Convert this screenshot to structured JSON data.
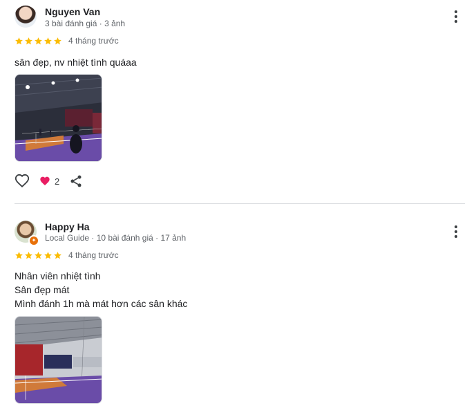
{
  "reviews": [
    {
      "author": "Nguyen Van",
      "meta": "3 bài đánh giá · 3 ảnh",
      "rating": 5,
      "time": "4 tháng trước",
      "text_lines": [
        "sân đẹp, nv nhiệt tình quáaa"
      ],
      "reaction_count": "2"
    },
    {
      "author": "Happy Ha",
      "meta": "Local Guide · 10 bài đánh giá · 17 ảnh",
      "rating": 5,
      "time": "4 tháng trước",
      "text_lines": [
        "Nhân viên nhiệt tình",
        "Sân đẹp mát",
        "Mình đánh 1h mà mát hơn các sân khác"
      ]
    }
  ],
  "colors": {
    "star": "#fbbc04",
    "heart_reaction": "#e91e63",
    "court": "#6a4ca8"
  },
  "icons": [
    "more-vert-icon",
    "star-icon",
    "heart-outline-icon",
    "heart-filled-icon",
    "share-icon"
  ]
}
